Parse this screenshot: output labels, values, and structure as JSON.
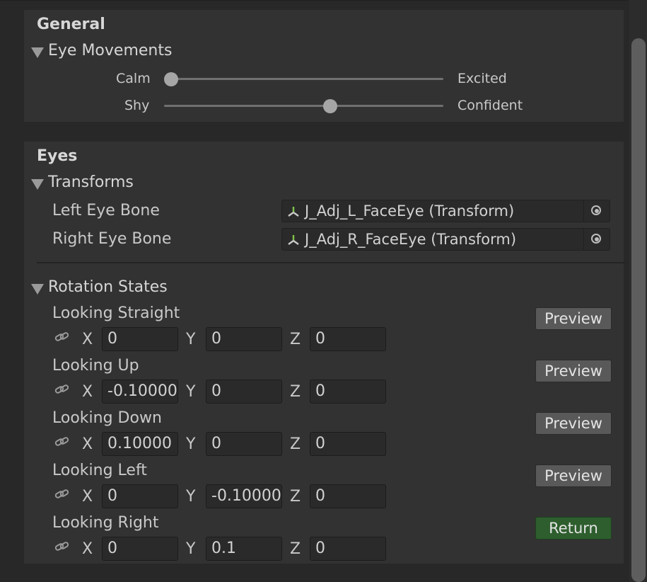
{
  "general": {
    "title": "General",
    "foldout": "Eye Movements",
    "sliders": [
      {
        "left_label": "Calm",
        "right_label": "Excited",
        "value": 0.0
      },
      {
        "left_label": "Shy",
        "right_label": "Confident",
        "value": 0.59
      }
    ]
  },
  "eyes": {
    "title": "Eyes",
    "transforms": {
      "foldout": "Transforms",
      "left_label": "Left Eye Bone",
      "left_value": "J_Adj_L_FaceEye (Transform)",
      "right_label": "Right Eye Bone",
      "right_value": "J_Adj_R_FaceEye (Transform)"
    },
    "rotation": {
      "foldout": "Rotation States",
      "axis_x": "X",
      "axis_y": "Y",
      "axis_z": "Z",
      "states": [
        {
          "label": "Looking Straight",
          "x": "0",
          "y": "0",
          "z": "0",
          "button": "Preview"
        },
        {
          "label": "Looking Up",
          "x": "-0.10000",
          "y": "0",
          "z": "0",
          "button": "Preview"
        },
        {
          "label": "Looking Down",
          "x": "0.10000",
          "y": "0",
          "z": "0",
          "button": "Preview"
        },
        {
          "label": "Looking Left",
          "x": "0",
          "y": "-0.10000",
          "z": "0",
          "button": "Preview"
        },
        {
          "label": "Looking Right",
          "x": "0",
          "y": "0.1",
          "z": "0",
          "button": "Return"
        }
      ]
    }
  },
  "colors": {
    "return_button": "#2e5e2e"
  },
  "icons": {
    "transform": "transform-axes-icon",
    "picker": "object-picker-icon",
    "constrain": "link-icon",
    "foldout": "triangle-down-icon"
  }
}
